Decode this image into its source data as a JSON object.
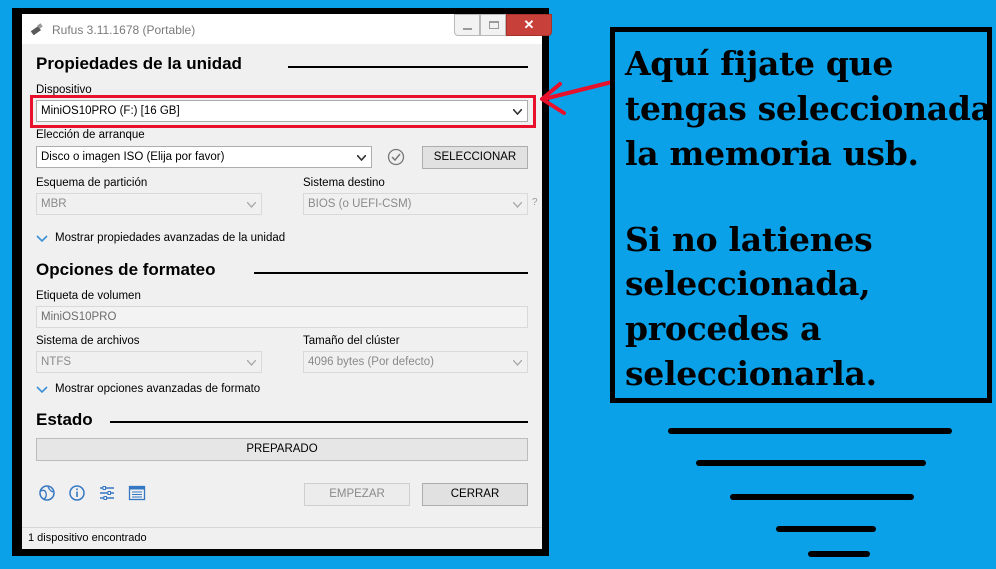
{
  "window": {
    "title": "Rufus 3.11.1678 (Portable)",
    "close_glyph": "✕"
  },
  "drive_properties": {
    "heading": "Propiedades de la unidad",
    "device_label": "Dispositivo",
    "device_value": "MiniOS10PRO (F:) [16 GB]",
    "boot_label": "Elección de arranque",
    "boot_value": "Disco o imagen ISO (Elija por favor)",
    "select_button": "SELECCIONAR",
    "partition_label": "Esquema de partición",
    "partition_value": "MBR",
    "target_label": "Sistema destino",
    "target_value": "BIOS (o UEFI-CSM)",
    "help_glyph": "?",
    "advanced_toggle": "Mostrar propiedades avanzadas de la unidad"
  },
  "format_options": {
    "heading": "Opciones de formateo",
    "volume_label": "Etiqueta de volumen",
    "volume_value": "MiniOS10PRO",
    "filesystem_label": "Sistema de archivos",
    "filesystem_value": "NTFS",
    "cluster_label": "Tamaño del clúster",
    "cluster_value": "4096 bytes (Por defecto)",
    "advanced_toggle": "Mostrar opciones avanzadas de formato"
  },
  "status": {
    "heading": "Estado",
    "progress_text": "PREPARADO",
    "start_button": "EMPEZAR",
    "close_button": "CERRAR",
    "statusbar_text": "1 dispositivo encontrado"
  },
  "toolbar_icons": [
    "globe-icon",
    "info-icon",
    "settings-icon",
    "log-icon"
  ],
  "annotation": {
    "line1": "Aquí fijate que",
    "line2": "tengas seleccionada",
    "line3": "la memoria usb.",
    "line4": "Si no latienes",
    "line5": "seleccionada,",
    "line6": "procedes a",
    "line7": "seleccionarla."
  },
  "colors": {
    "background": "#0aa1e8",
    "highlight": "#e8102a",
    "close_button": "#c7413a"
  }
}
